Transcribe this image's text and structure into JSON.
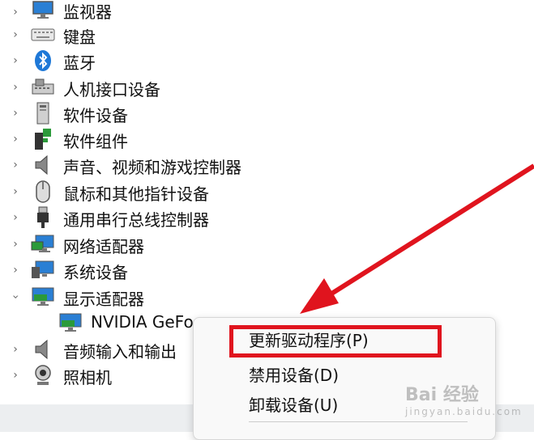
{
  "tree": {
    "items": [
      {
        "label": "监视器",
        "icon": "monitor-icon",
        "expanded": false
      },
      {
        "label": "键盘",
        "icon": "keyboard-icon",
        "expanded": false
      },
      {
        "label": "蓝牙",
        "icon": "bluetooth-icon",
        "expanded": false
      },
      {
        "label": "人机接口设备",
        "icon": "hid-icon",
        "expanded": false
      },
      {
        "label": "软件设备",
        "icon": "software-device-icon",
        "expanded": false
      },
      {
        "label": "软件组件",
        "icon": "software-component-icon",
        "expanded": false
      },
      {
        "label": "声音、视频和游戏控制器",
        "icon": "speaker-icon",
        "expanded": false
      },
      {
        "label": "鼠标和其他指针设备",
        "icon": "mouse-icon",
        "expanded": false
      },
      {
        "label": "通用串行总线控制器",
        "icon": "usb-icon",
        "expanded": false
      },
      {
        "label": "网络适配器",
        "icon": "network-adapter-icon",
        "expanded": false
      },
      {
        "label": "系统设备",
        "icon": "system-device-icon",
        "expanded": false
      },
      {
        "label": "显示适配器",
        "icon": "display-adapter-icon",
        "expanded": true
      },
      {
        "label": "音频输入和输出",
        "icon": "audio-io-icon",
        "expanded": false
      },
      {
        "label": "照相机",
        "icon": "camera-icon",
        "expanded": false
      }
    ],
    "child": {
      "label": "NVIDIA GeFo",
      "icon": "gpu-icon"
    }
  },
  "context_menu": {
    "items": [
      {
        "label": "更新驱动程序(P)",
        "highlighted": true
      },
      {
        "label": "禁用设备(D)"
      },
      {
        "label": "卸载设备(U)"
      }
    ]
  },
  "watermark": {
    "text": "Bai 经验",
    "sub": "jingyan.baidu.com"
  },
  "colors": {
    "highlight": "#e0141e",
    "arrow": "#e0141e"
  }
}
